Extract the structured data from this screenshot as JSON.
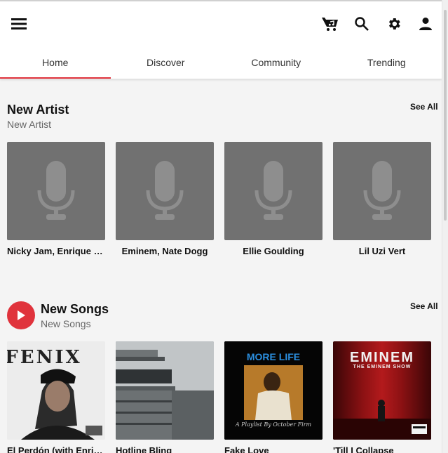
{
  "colors": {
    "accent": "#e0333c",
    "placeholder": "#717171",
    "mic": "#8e8e8e"
  },
  "header": {
    "icons": [
      "menu-icon",
      "music-cart-icon",
      "search-icon",
      "settings-icon",
      "account-icon"
    ]
  },
  "tabs": [
    {
      "label": "Home",
      "active": true
    },
    {
      "label": "Discover",
      "active": false
    },
    {
      "label": "Community",
      "active": false
    },
    {
      "label": "Trending",
      "active": false
    }
  ],
  "new_artist": {
    "title": "New Artist",
    "subtitle": "New Artist",
    "see_all": "See All",
    "items": [
      {
        "name": "Nicky Jam, Enrique Iglesias"
      },
      {
        "name": "Eminem, Nate Dogg"
      },
      {
        "name": "Ellie Goulding"
      },
      {
        "name": "Lil Uzi Vert"
      }
    ]
  },
  "new_songs": {
    "title": "New Songs",
    "subtitle": "New Songs",
    "see_all": "See All",
    "items": [
      {
        "name": "El Perdón (with Enrique Iglesias)",
        "art_text": "FENIX"
      },
      {
        "name": "Hotline Bling",
        "art_text": ""
      },
      {
        "name": "Fake Love",
        "art_text": "MORE LIFE",
        "art_subtext": "A Playlist By October Firm"
      },
      {
        "name": "'Till I Collapse",
        "art_text": "EMINEM",
        "art_subtext": "THE EMINEM SHOW"
      }
    ]
  }
}
